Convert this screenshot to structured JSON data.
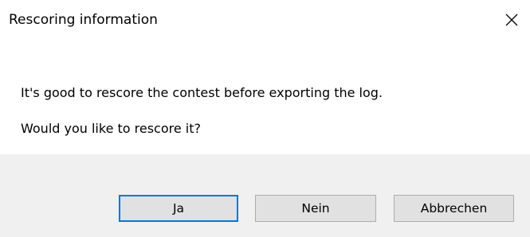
{
  "dialog": {
    "title": "Rescoring information",
    "message_line1": "It's good to rescore the contest before exporting the log.",
    "message_line2": "Would you like to rescore it?"
  },
  "buttons": {
    "yes_label": "Ja",
    "no_label": "Nein",
    "cancel_label": "Abbrechen"
  },
  "icons": {
    "close": "close-icon"
  },
  "colors": {
    "focus_border": "#0078d7",
    "button_face": "#e1e1e1",
    "footer_background": "#f0f0f0"
  }
}
